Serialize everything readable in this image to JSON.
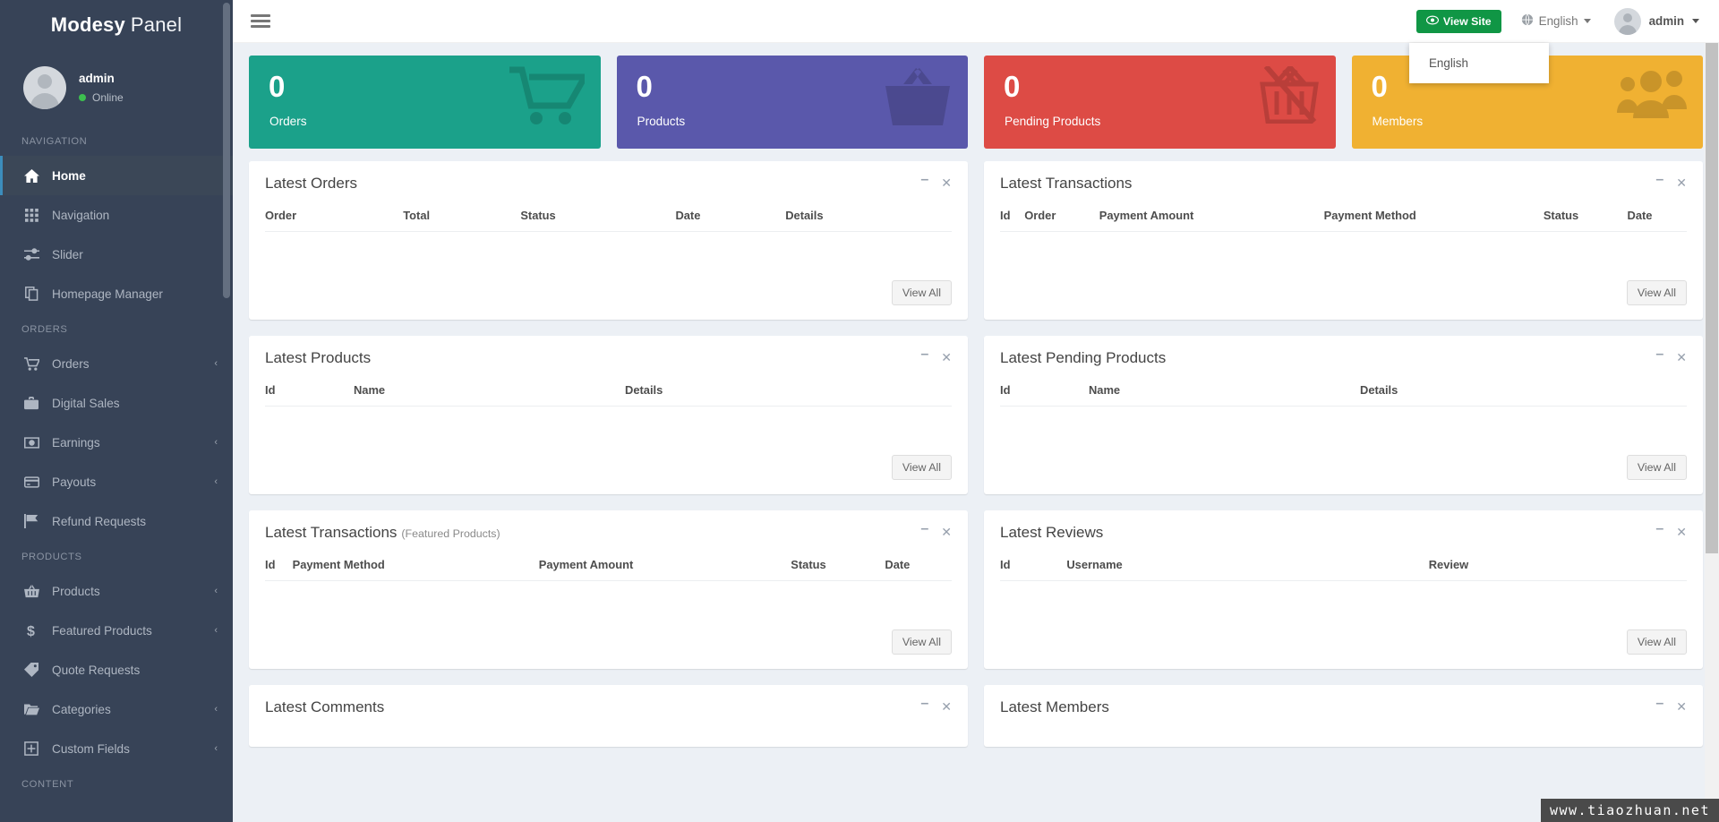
{
  "brand": {
    "bold": "Modesy",
    "light": "Panel"
  },
  "sidebar": {
    "user": {
      "name": "admin",
      "status": "Online"
    },
    "groups": [
      {
        "title": "NAVIGATION",
        "items": [
          {
            "label": "Home",
            "icon": "home-icon",
            "active": true,
            "caret": false
          },
          {
            "label": "Navigation",
            "icon": "grid-icon",
            "active": false,
            "caret": false
          },
          {
            "label": "Slider",
            "icon": "sliders-icon",
            "active": false,
            "caret": false
          },
          {
            "label": "Homepage Manager",
            "icon": "copy-icon",
            "active": false,
            "caret": false
          }
        ]
      },
      {
        "title": "ORDERS",
        "items": [
          {
            "label": "Orders",
            "icon": "cart-icon",
            "active": false,
            "caret": true
          },
          {
            "label": "Digital Sales",
            "icon": "briefcase-icon",
            "active": false,
            "caret": false
          },
          {
            "label": "Earnings",
            "icon": "money-icon",
            "active": false,
            "caret": true
          },
          {
            "label": "Payouts",
            "icon": "credit-card-icon",
            "active": false,
            "caret": true
          },
          {
            "label": "Refund Requests",
            "icon": "flag-icon",
            "active": false,
            "caret": false
          }
        ]
      },
      {
        "title": "PRODUCTS",
        "items": [
          {
            "label": "Products",
            "icon": "basket-icon",
            "active": false,
            "caret": true
          },
          {
            "label": "Featured Products",
            "icon": "dollar-icon",
            "active": false,
            "caret": true
          },
          {
            "label": "Quote Requests",
            "icon": "tag-icon",
            "active": false,
            "caret": false
          },
          {
            "label": "Categories",
            "icon": "folder-open-icon",
            "active": false,
            "caret": true
          },
          {
            "label": "Custom Fields",
            "icon": "plus-square-icon",
            "active": false,
            "caret": true
          }
        ]
      },
      {
        "title": "CONTENT",
        "items": []
      }
    ]
  },
  "topbar": {
    "view_site_label": "View Site",
    "language_label": "English",
    "user_label": "admin",
    "language_menu": {
      "items": [
        "English"
      ]
    }
  },
  "stats": [
    {
      "value": "0",
      "label": "Orders",
      "color": "#1ba18a",
      "icon": "cart-icon"
    },
    {
      "value": "0",
      "label": "Products",
      "color": "#5a58ab",
      "icon": "basket-icon"
    },
    {
      "value": "0",
      "label": "Pending Products",
      "color": "#dd4b45",
      "icon": "basket-off-icon"
    },
    {
      "value": "0",
      "label": "Members",
      "color": "#f0b132",
      "icon": "users-icon"
    }
  ],
  "panels": {
    "left": [
      {
        "title": "Latest Orders",
        "subtitle": "",
        "columns": [
          "Order",
          "Total",
          "Status",
          "Date",
          "Details"
        ],
        "view_all": "View All",
        "has_footer": true
      },
      {
        "title": "Latest Products",
        "subtitle": "",
        "columns": [
          "Id",
          "Name",
          "Details"
        ],
        "view_all": "View All",
        "has_footer": true
      },
      {
        "title": "Latest Transactions",
        "subtitle": "(Featured Products)",
        "columns": [
          "Id",
          "Payment Method",
          "Payment Amount",
          "Status",
          "Date"
        ],
        "view_all": "View All",
        "has_footer": true
      },
      {
        "title": "Latest Comments",
        "subtitle": "",
        "columns": [],
        "view_all": "",
        "has_footer": false
      }
    ],
    "right": [
      {
        "title": "Latest Transactions",
        "subtitle": "",
        "columns": [
          "Id",
          "Order",
          "Payment Amount",
          "Payment Method",
          "Status",
          "Date"
        ],
        "view_all": "View All",
        "has_footer": true
      },
      {
        "title": "Latest Pending Products",
        "subtitle": "",
        "columns": [
          "Id",
          "Name",
          "Details"
        ],
        "view_all": "View All",
        "has_footer": true
      },
      {
        "title": "Latest Reviews",
        "subtitle": "",
        "columns": [
          "Id",
          "Username",
          "Review"
        ],
        "view_all": "View All",
        "has_footer": true
      },
      {
        "title": "Latest Members",
        "subtitle": "",
        "columns": [],
        "view_all": "",
        "has_footer": false
      }
    ],
    "tools": {
      "minimize": "–",
      "close": "✕"
    }
  },
  "watermark": "www.tiaozhuan.net"
}
